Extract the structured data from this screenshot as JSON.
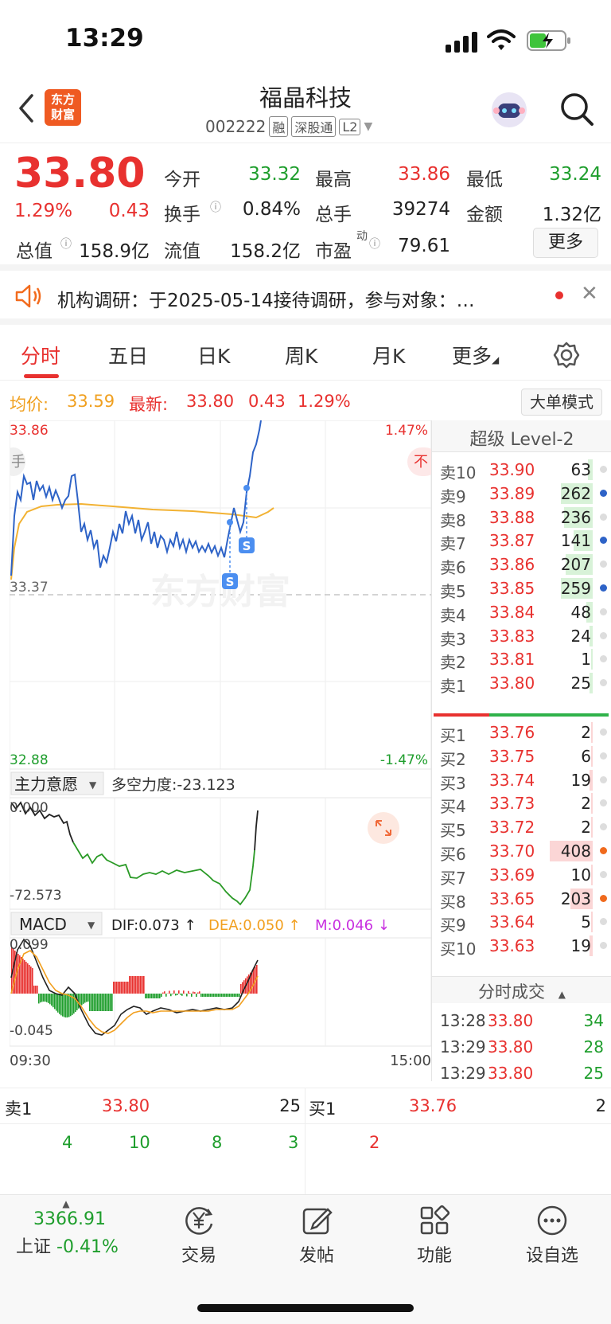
{
  "status": {
    "time": "13:29"
  },
  "header": {
    "name": "福晶科技",
    "code": "002222",
    "tags": [
      "融",
      "深股通",
      "L2"
    ],
    "logo_text": "东方\n财富"
  },
  "quote": {
    "price": "33.80",
    "change_pct": "1.29%",
    "change": "0.43",
    "open_label": "今开",
    "open": "33.32",
    "high_label": "最高",
    "high": "33.86",
    "low_label": "最低",
    "low": "33.24",
    "turnover_label": "换手",
    "turnover": "0.84%",
    "volume_label": "总手",
    "volume": "39274",
    "amount_label": "金额",
    "amount": "1.32亿",
    "mktcap_label": "总值",
    "mktcap": "158.9亿",
    "float_label": "流值",
    "float_cap": "158.2亿",
    "pe_label": "市盈",
    "pe_sup": "动",
    "pe": "79.61",
    "more": "更多"
  },
  "notice": {
    "text": "机构调研：于2025-05-14接待调研，参与对象：…"
  },
  "tabs": [
    "分时",
    "五日",
    "日K",
    "周K",
    "月K",
    "更多"
  ],
  "infobar": {
    "avg_label": "均价:",
    "avg": "33.59",
    "last_label": "最新:",
    "last": "33.80",
    "chg": "0.43",
    "pct": "1.29%",
    "bigorder": "大单模式"
  },
  "chart": {
    "y_top": "33.86",
    "y_mid": "33.37",
    "y_bot": "32.88",
    "pct_top": "1.47%",
    "pct_bot": "-1.47%",
    "watermark": "东方财富",
    "ind1_label": "主力意愿",
    "ind1_value": "多空力度:-23.123",
    "ind1_top": "0.000",
    "ind1_bot": "-72.573",
    "macd_label": "MACD",
    "dif": "DIF:0.073 ↑",
    "dea": "DEA:0.050 ↑",
    "m": "M:0.046 ↓",
    "macd_top": "0.099",
    "macd_bot": "-0.045",
    "t_start": "09:30",
    "t_end": "15:00",
    "side_left": "手",
    "side_right": "不"
  },
  "orderbook": {
    "title": "超级 Level-2",
    "sells": [
      {
        "label": "卖10",
        "price": "33.90",
        "vol": "63"
      },
      {
        "label": "卖9",
        "price": "33.89",
        "vol": "262"
      },
      {
        "label": "卖8",
        "price": "33.88",
        "vol": "236"
      },
      {
        "label": "卖7",
        "price": "33.87",
        "vol": "141"
      },
      {
        "label": "卖6",
        "price": "33.86",
        "vol": "207"
      },
      {
        "label": "卖5",
        "price": "33.85",
        "vol": "259"
      },
      {
        "label": "卖4",
        "price": "33.84",
        "vol": "48"
      },
      {
        "label": "卖3",
        "price": "33.83",
        "vol": "24"
      },
      {
        "label": "卖2",
        "price": "33.81",
        "vol": "1"
      },
      {
        "label": "卖1",
        "price": "33.80",
        "vol": "25"
      }
    ],
    "buys": [
      {
        "label": "买1",
        "price": "33.76",
        "vol": "2"
      },
      {
        "label": "买2",
        "price": "33.75",
        "vol": "6"
      },
      {
        "label": "买3",
        "price": "33.74",
        "vol": "19"
      },
      {
        "label": "买4",
        "price": "33.73",
        "vol": "2"
      },
      {
        "label": "买5",
        "price": "33.72",
        "vol": "2"
      },
      {
        "label": "买6",
        "price": "33.70",
        "vol": "408"
      },
      {
        "label": "买7",
        "price": "33.69",
        "vol": "10"
      },
      {
        "label": "买8",
        "price": "33.65",
        "vol": "203"
      },
      {
        "label": "买9",
        "price": "33.64",
        "vol": "5"
      },
      {
        "label": "买10",
        "price": "33.63",
        "vol": "19"
      }
    ],
    "trades_title": "分时成交",
    "trades": [
      {
        "time": "13:28",
        "price": "33.80",
        "vol": "34"
      },
      {
        "time": "13:29",
        "price": "33.80",
        "vol": "28"
      },
      {
        "time": "13:29",
        "price": "33.80",
        "vol": "25"
      }
    ]
  },
  "bottom_orders": {
    "sell_label": "卖1",
    "sell_price": "33.80",
    "sell_vol": "25",
    "sell_splits": [
      "4",
      "10",
      "8",
      "3"
    ],
    "buy_label": "买1",
    "buy_price": "33.76",
    "buy_vol": "2",
    "buy_splits": [
      "2"
    ]
  },
  "nav": {
    "index_value": "3366.91",
    "index_name": "上证",
    "index_pct": "-0.41%",
    "items": [
      "交易",
      "发帖",
      "功能",
      "设自选"
    ]
  }
}
